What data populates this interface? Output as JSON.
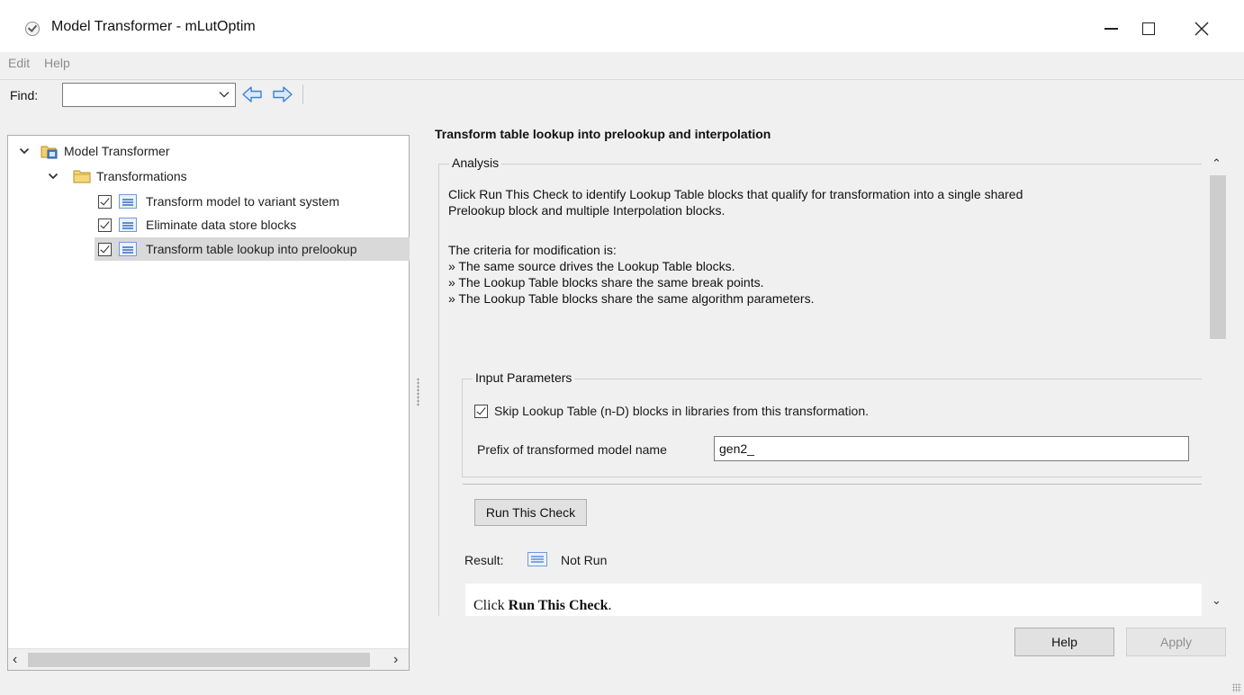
{
  "window": {
    "title": "Model Transformer - mLutOptim",
    "icon": "check-circle-icon"
  },
  "menu": {
    "items": [
      "Edit",
      "Help"
    ]
  },
  "toolbar": {
    "find_label": "Find:",
    "find_value": ""
  },
  "tree": {
    "root_label": "Model Transformer",
    "folder_label": "Transformations",
    "items": [
      {
        "label": "Transform model to variant system",
        "checked": true
      },
      {
        "label": "Eliminate data store blocks",
        "checked": true
      },
      {
        "label": "Transform table lookup into prelookup",
        "checked": true,
        "selected": true
      }
    ]
  },
  "main": {
    "heading": "Transform table lookup into prelookup and interpolation",
    "analysis_title": "Analysis",
    "description_lines": [
      "Click Run This Check to identify Lookup Table blocks that qualify for transformation into a single shared",
      "Prelookup block and multiple Interpolation blocks."
    ],
    "criteria_intro": "The criteria for modification is:",
    "criteria": [
      "» The same source drives the Lookup Table blocks.",
      "» The Lookup Table blocks share the same break points.",
      "» The Lookup Table blocks share the same algorithm parameters."
    ],
    "input_params_title": "Input Parameters",
    "skip_checkbox_label": "Skip Lookup Table (n-D) blocks in libraries from this transformation.",
    "skip_checked": true,
    "prefix_label": "Prefix of transformed model name",
    "prefix_value": "gen2_",
    "run_button": "Run This Check",
    "result_label": "Result:",
    "result_value": "Not Run",
    "result_text_prefix": "Click ",
    "result_text_bold": "Run This Check",
    "result_text_suffix": "."
  },
  "footer": {
    "help_button": "Help",
    "apply_button": "Apply"
  }
}
